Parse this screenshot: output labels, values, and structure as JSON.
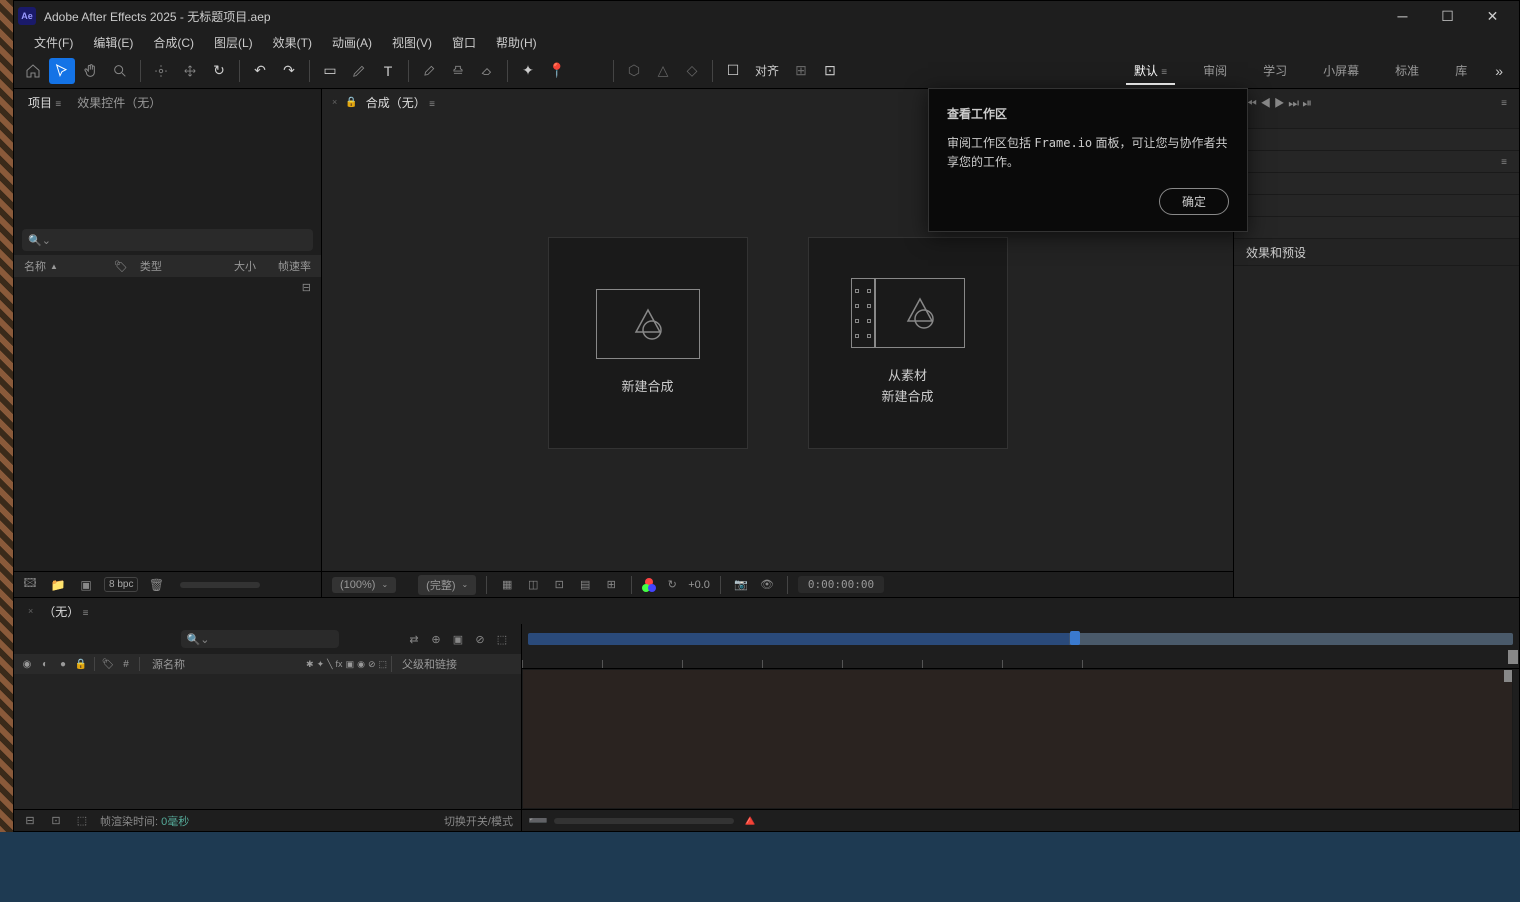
{
  "titlebar": {
    "app_icon": "Ae",
    "text": "Adobe After Effects 2025 - 无标题项目.aep"
  },
  "menubar": [
    "文件(F)",
    "编辑(E)",
    "合成(C)",
    "图层(L)",
    "效果(T)",
    "动画(A)",
    "视图(V)",
    "窗口",
    "帮助(H)"
  ],
  "toolbar": {
    "align_label": "对齐"
  },
  "workspaces": [
    "默认",
    "审阅",
    "学习",
    "小屏幕",
    "标准",
    "库"
  ],
  "project_panel": {
    "tab1": "项目",
    "tab2": "效果控件（无）",
    "col_name": "名称",
    "col_type": "类型",
    "col_size": "大小",
    "col_fps": "帧速率",
    "bpc": "8 bpc"
  },
  "comp_panel": {
    "tab": "合成（无）",
    "card1": "新建合成",
    "card2_l1": "从素材",
    "card2_l2": "新建合成",
    "footer": {
      "zoom": "(100%)",
      "res": "(完整)",
      "exposure": "+0.0",
      "time": "0:00:00:00"
    }
  },
  "right_panel": {
    "effects_presets": "效果和预设"
  },
  "tooltip": {
    "title": "查看工作区",
    "body_pre": "审阅工作区包括 ",
    "body_code": "Frame.io",
    "body_post": " 面板，可让您与协作者共享您的工作。",
    "ok": "确定"
  },
  "timeline": {
    "tab": "（无）",
    "source_name": "源名称",
    "parent_link": "父级和链接",
    "frame_render_label": "帧渲染时间:",
    "frame_render_value": "0毫秒",
    "toggle_switches": "切换开关/模式"
  }
}
